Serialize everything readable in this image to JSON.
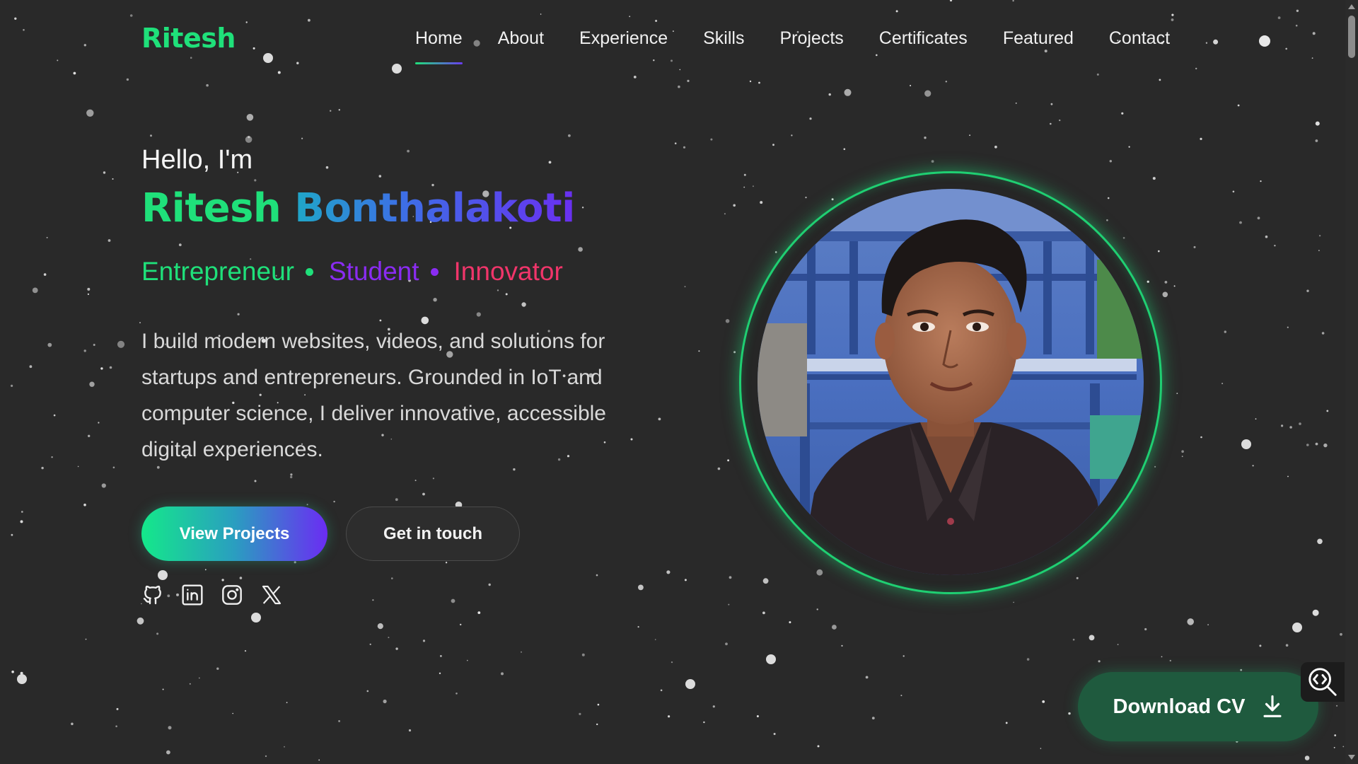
{
  "nav": {
    "logo": "Ritesh",
    "items": [
      {
        "label": "Home",
        "active": true
      },
      {
        "label": "About"
      },
      {
        "label": "Experience"
      },
      {
        "label": "Skills"
      },
      {
        "label": "Projects"
      },
      {
        "label": "Certificates"
      },
      {
        "label": "Featured"
      },
      {
        "label": "Contact"
      }
    ]
  },
  "hero": {
    "greeting": "Hello, I'm",
    "first_name": "Ritesh",
    "last_name": "Bonthalakoti",
    "roles": [
      "Entrepreneur",
      "Student",
      "Innovator"
    ],
    "bio": "I build modern websites, videos, and solutions for startups and entrepreneurs. Grounded in IoT and computer science, I deliver innovative, accessible digital experiences.",
    "primary_button": "View Projects",
    "secondary_button": "Get in touch",
    "socials": [
      "github-icon",
      "linkedin-icon",
      "instagram-icon",
      "x-icon"
    ]
  },
  "download_button": "Download CV",
  "colors": {
    "background": "#292929",
    "accent_green": "#1fe07a",
    "accent_purple": "#8a2cf2",
    "accent_pink": "#f0356a",
    "download_bg": "#1f5a3e"
  }
}
